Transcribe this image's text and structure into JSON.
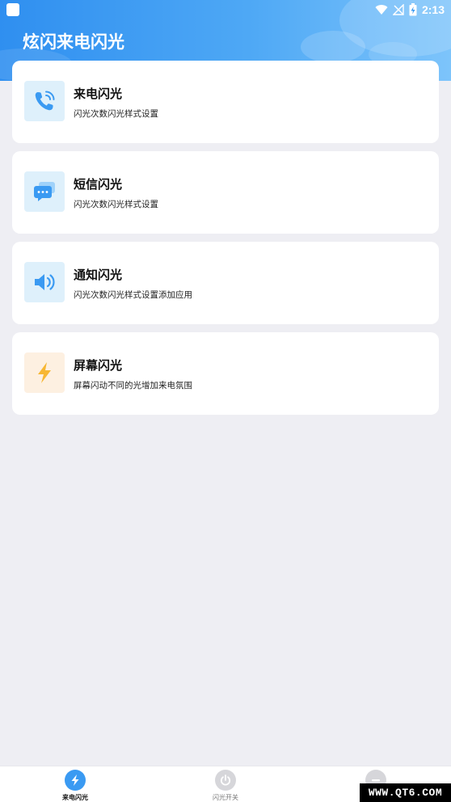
{
  "status_bar": {
    "time": "2:13"
  },
  "app": {
    "title": "炫闪来电闪光"
  },
  "cards": [
    {
      "title": "来电闪光",
      "subtitle": "闪光次数闪光样式设置",
      "icon": "phone-ringing-icon"
    },
    {
      "title": "短信闪光",
      "subtitle": "闪光次数闪光样式设置",
      "icon": "message-bubble-icon"
    },
    {
      "title": "通知闪光",
      "subtitle": "闪光次数闪光样式设置添加应用",
      "icon": "speaker-icon"
    },
    {
      "title": "屏幕闪光",
      "subtitle": "屏幕闪动不同的光增加来电氛围",
      "icon": "lightning-bolt-icon"
    }
  ],
  "tabs": [
    {
      "label": "来电闪光",
      "icon": "lightning-tab-icon",
      "active": true
    },
    {
      "label": "闪光开关",
      "icon": "power-icon",
      "active": false
    },
    {
      "label": "",
      "icon": "minus-circle-icon",
      "active": false
    }
  ],
  "watermark": "WWW.QT6.COM",
  "colors": {
    "header_start": "#2f8ff0",
    "header_end": "#7dc4fb",
    "accent_blue": "#3a9af2",
    "icon_bg_blue": "#def0fb",
    "icon_bg_warm": "#fdf0e1",
    "bolt": "#f7b733",
    "background": "#eeeef3"
  }
}
